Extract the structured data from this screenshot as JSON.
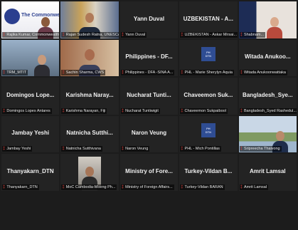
{
  "tiles": [
    {
      "name": "",
      "label": "Rajika Kumar, Commonwealth",
      "video": "commonwealth"
    },
    {
      "name": "",
      "label": "Rajan Sudesh Ratna, UNESCAP",
      "video": "speaker-flags",
      "active": true
    },
    {
      "name": "Yann Duval",
      "label": "Yann Duval",
      "video": null
    },
    {
      "name": "UZBEKISTAN - A...",
      "label": "UZBEKISTAN - Askar Mirsai...",
      "video": null
    },
    {
      "name": "",
      "label": "Shabnam...",
      "video": "woman-white"
    },
    {
      "name": "",
      "label": "TRM_MTIT",
      "video": "room"
    },
    {
      "name": "",
      "label": "Sachin Sharma, CWS",
      "video": "man-office"
    },
    {
      "name": "Philippines - DF...",
      "label": "Philippines - DFA -SINA A...",
      "video": null
    },
    {
      "name": "",
      "label": "PHL - Marie Sherylyn Aquia",
      "video": "logo"
    },
    {
      "name": "Witada Anukoo...",
      "label": "Witada Anukoonwattaka",
      "video": null
    },
    {
      "name": "Domingos Lope...",
      "label": "Domingos Lopes Antares",
      "video": null
    },
    {
      "name": "Karishma Naray...",
      "label": "Karishma Narayan, Fiji",
      "video": null
    },
    {
      "name": "Nucharat Tunti...",
      "label": "Nucharat Tuntiwigit",
      "video": null
    },
    {
      "name": "Chaveemon Suk...",
      "label": "Chaveemon Sukpaibool",
      "video": null
    },
    {
      "name": "Bangladesh_Sye...",
      "label": "Bangladesh_Syed Rashedul...",
      "video": null
    },
    {
      "name": "Jambay Yeshi",
      "label": "Jambay Yeshi",
      "video": null
    },
    {
      "name": "Natnicha Sutthi...",
      "label": "Natnicha Sutthivana",
      "video": null
    },
    {
      "name": "Naron Veung",
      "label": "Naron Veung",
      "video": null
    },
    {
      "name": "",
      "label": "PHL - Mich Pontillas",
      "video": "logo"
    },
    {
      "name": "",
      "label": "Sripreecha Thaivong",
      "video": "outdoor"
    },
    {
      "name": "Thanyakarn_DTN",
      "label": "Thanyakarn_DTN",
      "video": null
    },
    {
      "name": "",
      "label": "MoC Cambodia-Moeng Ph...",
      "video": "man-standing"
    },
    {
      "name": "Ministry of Fore...",
      "label": "Ministry of Foreign Affairs...",
      "video": null
    },
    {
      "name": "Turkey-Vildan B...",
      "label": "Turkey-Vildan BARAN",
      "video": null
    },
    {
      "name": "Amrit Lamsal",
      "label": "Amrit Lamsal",
      "video": null
    }
  ],
  "logo_text": "PH\nDTN",
  "commonwealth_text": "The Commonwealth",
  "colors": {
    "active_border": "#9fd13a",
    "tile_bg": "#232323",
    "muted_mic": "#e0413b"
  },
  "icons": {
    "muted": "muted-mic-icon"
  }
}
